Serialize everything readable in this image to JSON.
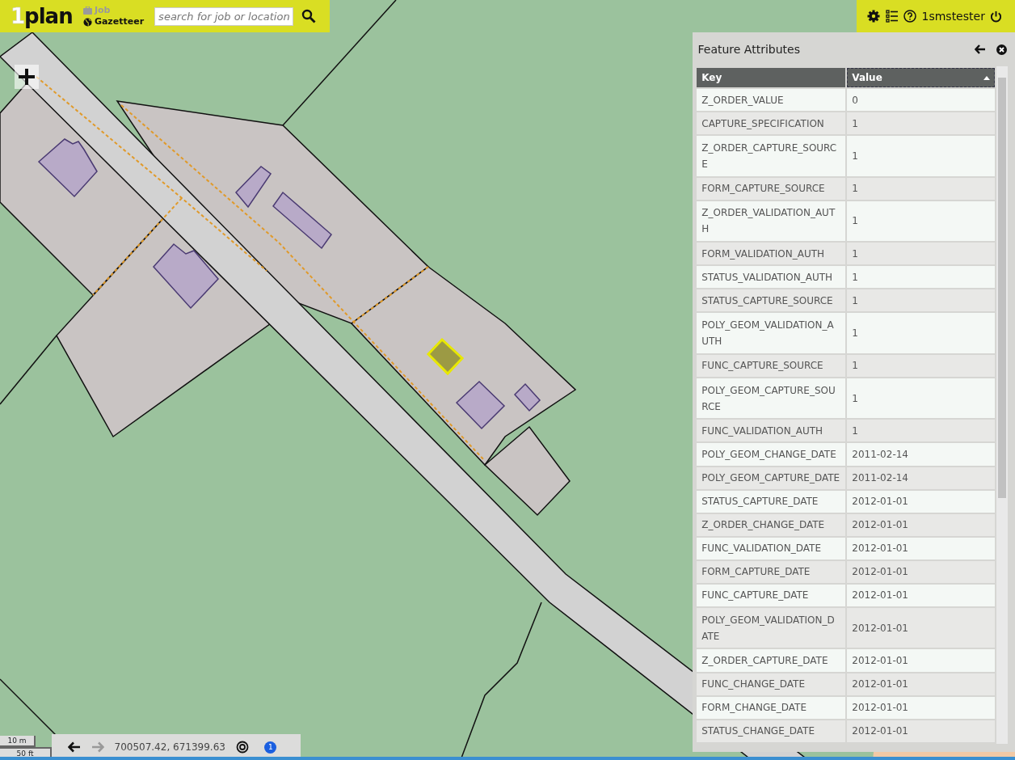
{
  "header": {
    "logo": {
      "mark": "1",
      "word": "plan"
    },
    "menu": [
      {
        "label": "Job",
        "kind": "job",
        "disabled": true
      },
      {
        "label": "Gazetteer",
        "kind": "gazetteer",
        "disabled": false
      }
    ],
    "search": {
      "placeholder": "search for job or location"
    },
    "user": "1smstester"
  },
  "panel": {
    "title": "Feature Attributes",
    "columns": [
      {
        "label": "Key",
        "sorted": false
      },
      {
        "label": "Value",
        "sorted": true
      }
    ],
    "rows": [
      [
        "Z_ORDER_VALUE",
        "0"
      ],
      [
        "CAPTURE_SPECIFICATION",
        "1"
      ],
      [
        "Z_ORDER_CAPTURE_SOURCE",
        "1"
      ],
      [
        "FORM_CAPTURE_SOURCE",
        "1"
      ],
      [
        "Z_ORDER_VALIDATION_AUTH",
        "1"
      ],
      [
        "FORM_VALIDATION_AUTH",
        "1"
      ],
      [
        "STATUS_VALIDATION_AUTH",
        "1"
      ],
      [
        "STATUS_CAPTURE_SOURCE",
        "1"
      ],
      [
        "POLY_GEOM_VALIDATION_AUTH",
        "1"
      ],
      [
        "FUNC_CAPTURE_SOURCE",
        "1"
      ],
      [
        "POLY_GEOM_CAPTURE_SOURCE",
        "1"
      ],
      [
        "FUNC_VALIDATION_AUTH",
        "1"
      ],
      [
        "POLY_GEOM_CHANGE_DATE",
        "2011-02-14"
      ],
      [
        "POLY_GEOM_CAPTURE_DATE",
        "2011-02-14"
      ],
      [
        "STATUS_CAPTURE_DATE",
        "2012-01-01"
      ],
      [
        "Z_ORDER_CHANGE_DATE",
        "2012-01-01"
      ],
      [
        "FUNC_VALIDATION_DATE",
        "2012-01-01"
      ],
      [
        "FORM_CAPTURE_DATE",
        "2012-01-01"
      ],
      [
        "FUNC_CAPTURE_DATE",
        "2012-01-01"
      ],
      [
        "POLY_GEOM_VALIDATION_DATE",
        "2012-01-01"
      ],
      [
        "Z_ORDER_CAPTURE_DATE",
        "2012-01-01"
      ],
      [
        "FUNC_CHANGE_DATE",
        "2012-01-01"
      ],
      [
        "FORM_CHANGE_DATE",
        "2012-01-01"
      ],
      [
        "STATUS_CHANGE_DATE",
        "2012-01-01"
      ]
    ]
  },
  "scale": {
    "metric": "10 m",
    "imperial": "50 ft"
  },
  "footer": {
    "coordinates": "700507.42, 671399.63",
    "back_enabled": true,
    "forward_enabled": false,
    "badge": "1"
  }
}
